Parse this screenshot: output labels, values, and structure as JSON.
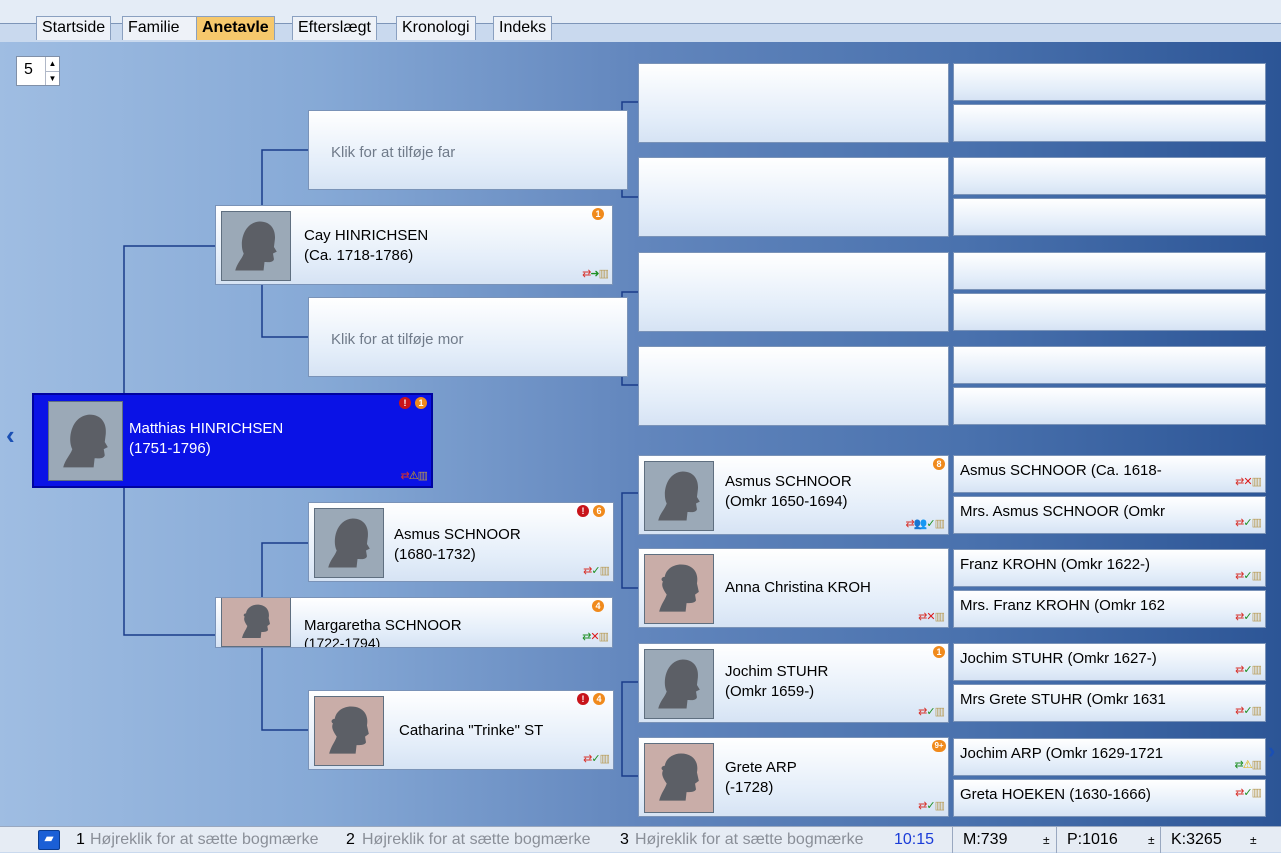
{
  "tabs": [
    {
      "label": "Startside"
    },
    {
      "label": "Familie"
    },
    {
      "label": "Anetavle"
    },
    {
      "label": "Efterslægt"
    },
    {
      "label": "Kronologi"
    },
    {
      "label": "Indeks"
    }
  ],
  "generations": "5",
  "root": {
    "name": "Matthias HINRICHSEN",
    "years": "(1751-1796)"
  },
  "father": {
    "name": "Cay HINRICHSEN",
    "years": "(Ca. 1718-1786)"
  },
  "mother": {
    "name": "Margaretha SCHNOOR",
    "years": "(1722-1794)"
  },
  "add_father": "Klik for at tilføje far",
  "add_mother": "Klik for at tilføje mor",
  "mf": {
    "name": "Asmus SCHNOOR",
    "years": "(1680-1732)"
  },
  "mm": {
    "name": "Catharina \"Trinke\" ST"
  },
  "gen4": [
    {
      "name": "Asmus SCHNOOR",
      "years": "(Omkr 1650-1694)"
    },
    {
      "name": "Anna Christina KROH"
    },
    {
      "name": "Jochim STUHR",
      "years": "(Omkr 1659-)"
    },
    {
      "name": "Grete ARP",
      "years": "(-1728)"
    }
  ],
  "gen5": [
    "Asmus SCHNOOR (Ca. 1618-",
    "Mrs. Asmus SCHNOOR (Omkr",
    "Franz KROHN (Omkr 1622-)",
    "Mrs. Franz KROHN (Omkr 162",
    "Jochim STUHR (Omkr 1627-)",
    "Mrs Grete STUHR (Omkr 1631",
    "Jochim ARP (Omkr 1629-1721",
    "Greta HOEKEN (1630-1666)"
  ],
  "badges": {
    "root": [
      "!",
      "1"
    ],
    "father": [
      "1"
    ],
    "mother": [
      "4"
    ],
    "mf": [
      "!",
      "6"
    ],
    "mm": [
      "!",
      "4"
    ],
    "g4": [
      "8",
      "",
      "1",
      "9+"
    ]
  },
  "bookmarks": [
    {
      "num": "1",
      "text": "Højreklik for at sætte bogmærke"
    },
    {
      "num": "2",
      "text": "Højreklik for at sætte bogmærke"
    },
    {
      "num": "3",
      "text": "Højreklik for at sætte bogmærke"
    }
  ],
  "status": {
    "time": "10:15",
    "m": "M:739",
    "p": "P:1016",
    "k": "K:3265",
    "pm": "±"
  },
  "colors": {
    "selected": "#0a12e6",
    "link": "#1a4fb4",
    "tab_active": "#f6c86c"
  }
}
